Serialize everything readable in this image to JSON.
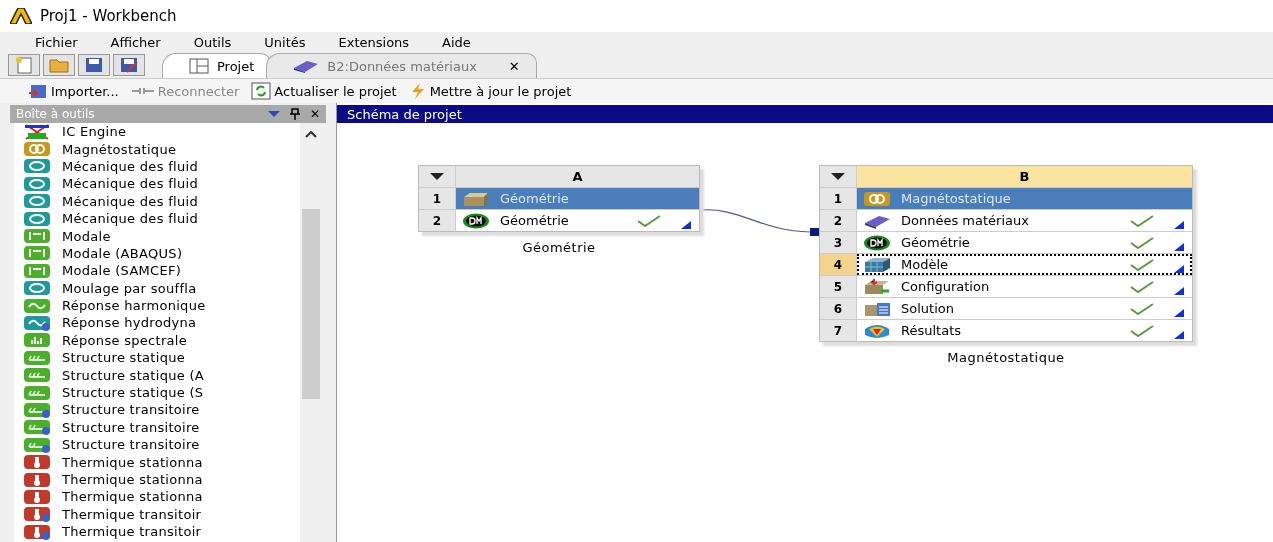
{
  "window": {
    "title": "Proj1 - Workbench"
  },
  "menu": [
    "Fichier",
    "Afficher",
    "Outils",
    "Unités",
    "Extensions",
    "Aide"
  ],
  "quick_tools": [
    {
      "kind": "new"
    },
    {
      "kind": "open"
    },
    {
      "kind": "save"
    },
    {
      "kind": "saveas"
    }
  ],
  "tabs": [
    {
      "label": "Projet",
      "selected": true,
      "kind": "project"
    },
    {
      "label": "B2:Données matériaux",
      "selected": false,
      "kind": "material",
      "close": "✕"
    }
  ],
  "toolbar": [
    {
      "label": "Importer...",
      "kind": "import",
      "disabled": false
    },
    {
      "label": "Reconnecter",
      "kind": "reconnect",
      "disabled": true
    },
    {
      "label": "Actualiser le projet",
      "kind": "refresh",
      "disabled": false
    },
    {
      "label": "Mettre à jour le projet",
      "kind": "update",
      "disabled": false
    }
  ],
  "toolbox": {
    "title": "Boîte à outils",
    "close": "✕",
    "items": [
      {
        "label": "IC Engine",
        "kind": "engine"
      },
      {
        "label": "Magnétostatique",
        "kind": "magnet"
      },
      {
        "label": "Mécanique des fluid",
        "kind": "fluid"
      },
      {
        "label": "Mécanique des fluid",
        "kind": "fluid"
      },
      {
        "label": "Mécanique des fluid",
        "kind": "fluid"
      },
      {
        "label": "Mécanique des fluid",
        "kind": "fluid"
      },
      {
        "label": "Modale",
        "kind": "modal"
      },
      {
        "label": "Modale (ABAQUS)",
        "kind": "modal"
      },
      {
        "label": "Modale (SAMCEF)",
        "kind": "modal"
      },
      {
        "label": "Moulage par souffla",
        "kind": "fluid"
      },
      {
        "label": "Réponse harmonique",
        "kind": "harmonic"
      },
      {
        "label": "Réponse hydrodyna",
        "kind": "hydro"
      },
      {
        "label": "Réponse spectrale",
        "kind": "spectral"
      },
      {
        "label": "Structure statique",
        "kind": "static"
      },
      {
        "label": "Structure statique (A",
        "kind": "static"
      },
      {
        "label": "Structure statique (S",
        "kind": "static"
      },
      {
        "label": "Structure transitoire",
        "kind": "transient"
      },
      {
        "label": "Structure transitoire",
        "kind": "transient"
      },
      {
        "label": "Structure transitoire",
        "kind": "transient"
      },
      {
        "label": "Thermique stationna",
        "kind": "thermal"
      },
      {
        "label": "Thermique stationna",
        "kind": "thermal"
      },
      {
        "label": "Thermique stationna",
        "kind": "thermal"
      },
      {
        "label": "Thermique transitoir",
        "kind": "thermal-transient"
      },
      {
        "label": "Thermique transitoir",
        "kind": "thermal-transient"
      }
    ]
  },
  "schematic": {
    "title": "Schéma de projet",
    "systems": [
      {
        "letter": "A",
        "caption": "Géométrie",
        "rows": [
          {
            "num": "1",
            "label": "Géométrie",
            "kind": "block",
            "up_to_date": false,
            "header": true,
            "focused": false
          },
          {
            "num": "2",
            "label": "Géométrie",
            "kind": "dm",
            "up_to_date": true,
            "header": false,
            "focused": false
          }
        ]
      },
      {
        "letter": "B",
        "caption": "Magnétostatique",
        "rows": [
          {
            "num": "1",
            "label": "Magnétostatique",
            "kind": "magnet",
            "up_to_date": false,
            "header": true,
            "focused": false
          },
          {
            "num": "2",
            "label": "Données matériaux",
            "kind": "book",
            "up_to_date": true,
            "header": false,
            "focused": false
          },
          {
            "num": "3",
            "label": "Géométrie",
            "kind": "dm",
            "up_to_date": true,
            "header": false,
            "focused": false
          },
          {
            "num": "4",
            "label": "Modèle",
            "kind": "mesh",
            "up_to_date": true,
            "header": false,
            "focused": true
          },
          {
            "num": "5",
            "label": "Configuration",
            "kind": "setup",
            "up_to_date": true,
            "header": false,
            "focused": false
          },
          {
            "num": "6",
            "label": "Solution",
            "kind": "solution",
            "up_to_date": true,
            "header": false,
            "focused": false
          },
          {
            "num": "7",
            "label": "Résultats",
            "kind": "results",
            "up_to_date": true,
            "header": false,
            "focused": false
          }
        ]
      }
    ]
  }
}
